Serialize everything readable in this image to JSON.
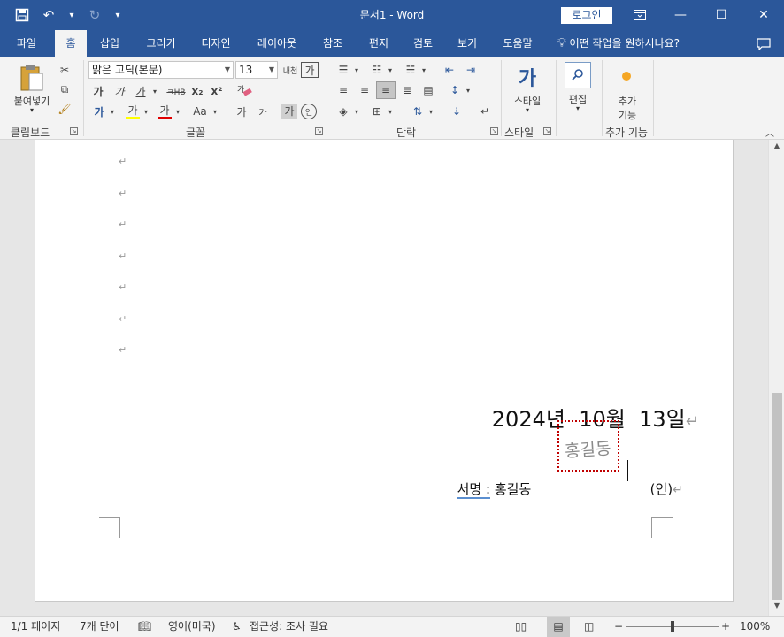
{
  "window": {
    "title": "문서1 - Word",
    "login_label": "로그인",
    "ribbon_display_icon": "ribbon-display-options-icon",
    "minimize_glyph": "—",
    "maximize_glyph": "☐",
    "close_glyph": "✕"
  },
  "qat": {
    "save_icon": "save-icon",
    "undo_icon": "undo-icon",
    "redo_icon": "redo-icon",
    "customize_icon": "customize-qat-icon"
  },
  "tabs": [
    {
      "label": "파일"
    },
    {
      "label": "홈"
    },
    {
      "label": "삽입"
    },
    {
      "label": "그리기"
    },
    {
      "label": "디자인"
    },
    {
      "label": "레이아웃"
    },
    {
      "label": "참조"
    },
    {
      "label": "편지"
    },
    {
      "label": "검토"
    },
    {
      "label": "보기"
    },
    {
      "label": "도움말"
    }
  ],
  "tell_me": {
    "placeholder": "어떤 작업을 원하시나요?"
  },
  "ribbon": {
    "clipboard": {
      "paste_label": "붙여넣기",
      "group_label": "클립보드"
    },
    "font": {
      "font_name": "맑은 고딕(본문)",
      "font_size": "13",
      "group_label": "글꼴",
      "bold": "가",
      "italic": "가",
      "underline": "가",
      "strike": "ㅋHB",
      "subscript": "x₂",
      "superscript": "x²",
      "grow": "가",
      "shrink": "가",
      "aa": "Aa",
      "font_color": "가",
      "highlight": "가",
      "char_shading": "가",
      "enclose": "인",
      "hanja": "내천",
      "phonetic": "가"
    },
    "paragraph": {
      "group_label": "단락"
    },
    "styles": {
      "label": "스타일",
      "group_label": "스타일"
    },
    "editing": {
      "label": "편집"
    },
    "addins": {
      "label_line1": "추가",
      "label_line2": "기능",
      "group_label": "추가 기능"
    }
  },
  "document": {
    "date_line": "2024년  10월  13일",
    "signature_label": "서명",
    "signature_colon": ":",
    "signature_name": "홍길동",
    "seal_text": "(인)",
    "handwritten_signature": "홍길동",
    "para_mark": "↵"
  },
  "status": {
    "page": "1/1 페이지",
    "words": "7개 단어",
    "language": "영어(미국)",
    "accessibility": "접근성: 조사 필요",
    "zoom": "100%",
    "zoom_minus": "−",
    "zoom_plus": "+",
    "zoom_level": 0.5
  },
  "colors": {
    "accent": "#2b579a",
    "font_color_bar": "#e00000",
    "highlight_bar": "#ffff00",
    "signature_box_border": "#c00000",
    "addin_dot": "#f5a623"
  }
}
